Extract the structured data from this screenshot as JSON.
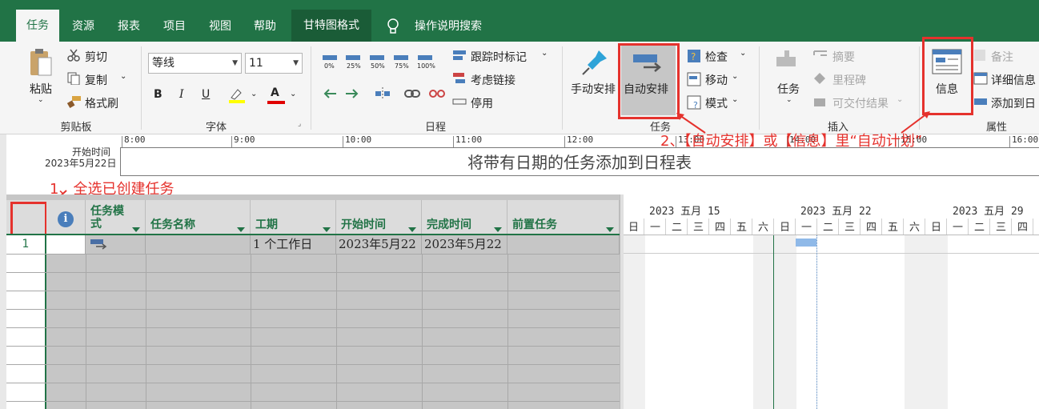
{
  "tabs": {
    "task": "任务",
    "resource": "资源",
    "report": "报表",
    "project": "项目",
    "view": "视图",
    "help": "帮助",
    "gantt_format": "甘特图格式",
    "search": "操作说明搜索"
  },
  "clipboard": {
    "paste": "粘贴",
    "cut": "剪切",
    "copy": "复制",
    "format_painter": "格式刷",
    "group": "剪贴板"
  },
  "font": {
    "name": "等线",
    "size": "11",
    "bold": "B",
    "italic": "I",
    "underline": "U",
    "color_a": "A",
    "group": "字体"
  },
  "schedule": {
    "percent": [
      "0%",
      "25%",
      "50%",
      "75%",
      "100%"
    ],
    "track_mark": "跟踪时标记",
    "respect_links": "考虑链接",
    "inactivate": "停用",
    "group": "日程"
  },
  "tasks_grp": {
    "manual": "手动安排",
    "auto": "自动安排",
    "inspect": "检查",
    "move": "移动",
    "mode": "模式",
    "group": "任务"
  },
  "insert": {
    "task": "任务",
    "summary": "摘要",
    "milestone": "里程碑",
    "deliverable": "可交付结果",
    "group": "插入"
  },
  "properties": {
    "info": "信息",
    "notes": "备注",
    "details": "详细信息",
    "add_timeline": "添加到日",
    "group": "属性"
  },
  "annotations": {
    "step1": "1、全选已创建任务",
    "step2": "2、【自动安排】或【信息】里“自动计划”"
  },
  "timeline": {
    "start_label": "开始时间",
    "start_date": "2023年5月22日",
    "ticks": [
      "8:00",
      "9:00",
      "10:00",
      "11:00",
      "12:00",
      "13:00",
      "14:00",
      "15:00",
      "16:00"
    ],
    "placeholder": "将带有日期的任务添加到日程表"
  },
  "grid": {
    "headers": {
      "info": "i",
      "mode": "任务模式",
      "name": "任务名称",
      "duration": "工期",
      "start": "开始时间",
      "finish": "完成时间",
      "pred": "前置任务"
    },
    "rows": [
      {
        "id": "1",
        "mode_icon": "auto-schedule-icon",
        "name": "",
        "duration": "1 个工作日",
        "start": "2023年5月22",
        "finish": "2023年5月22",
        "pred": ""
      }
    ]
  },
  "gantt": {
    "weeks": [
      "2023 五月 15",
      "2023 五月 22",
      "2023 五月 29"
    ],
    "days": [
      "日",
      "一",
      "二",
      "三",
      "四",
      "五",
      "六",
      "日",
      "一",
      "二",
      "三",
      "四",
      "五",
      "六",
      "日",
      "一",
      "二",
      "三",
      "四"
    ],
    "bar_color": "#8fb9e8"
  },
  "colors": {
    "accent": "#217346",
    "annotation": "#e5322d"
  }
}
